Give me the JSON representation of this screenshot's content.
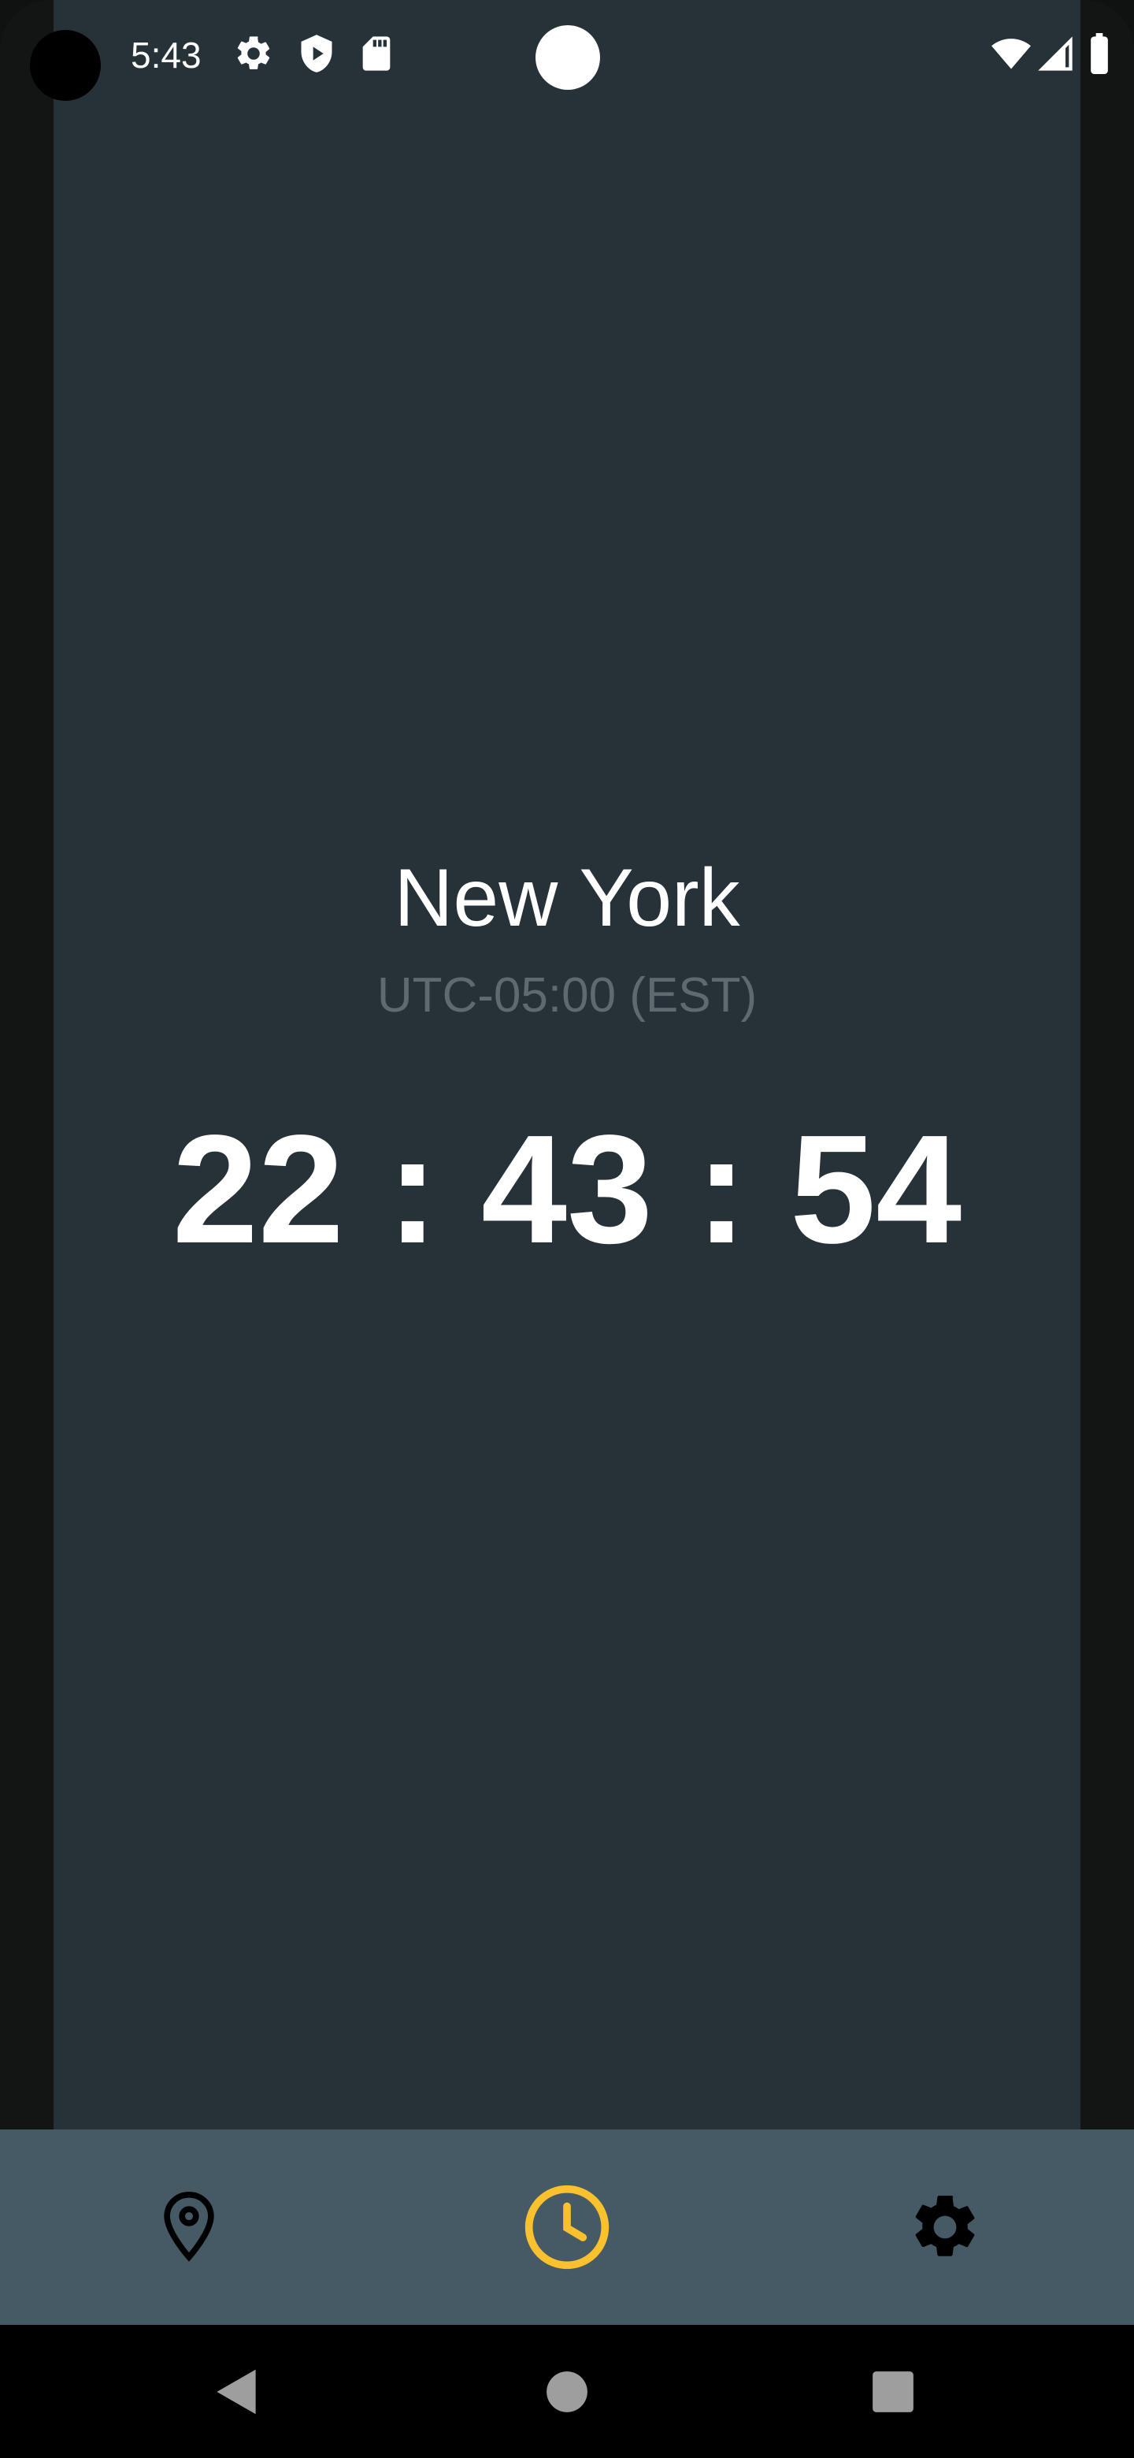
{
  "status_bar": {
    "time": "5:43",
    "icons": [
      "gear-icon",
      "shield-play-icon",
      "sd-card-icon",
      "wifi-icon",
      "signal-icon",
      "battery-icon"
    ]
  },
  "main": {
    "city": "New York",
    "timezone": "UTC-05:00 (EST)",
    "clock": "22 : 43 : 54"
  },
  "bottom_nav": {
    "items": [
      {
        "icon": "location-pin-icon",
        "selected": false
      },
      {
        "icon": "clock-icon",
        "selected": true
      },
      {
        "icon": "settings-gear-icon",
        "selected": false
      }
    ],
    "accent_color": "#FBC02D"
  },
  "system_nav": {
    "buttons": [
      "back-icon",
      "home-icon",
      "recents-icon"
    ]
  }
}
